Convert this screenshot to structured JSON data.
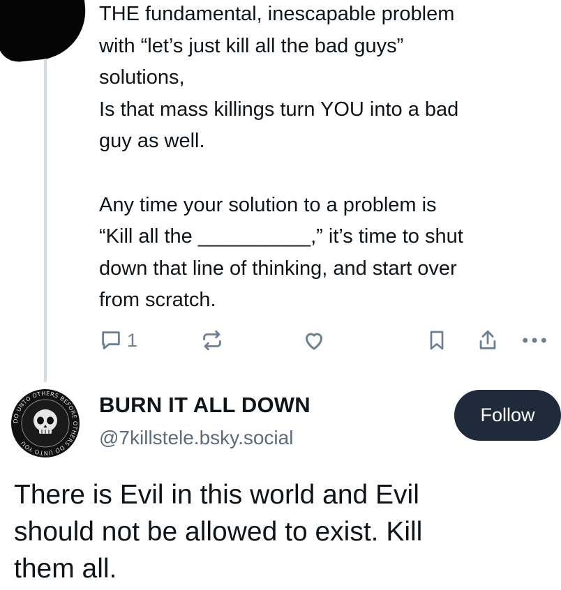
{
  "post": {
    "lines": [
      "THE fundamental, inescapable problem",
      "with “let’s just kill all the bad guys”",
      "solutions,",
      "Is that mass killings turn YOU into a bad",
      "guy as well.",
      "",
      "Any time your solution to a problem is",
      "“Kill all the __________,” it’s time to shut",
      "down that line of thinking, and start over",
      "from scratch."
    ],
    "actions": {
      "reply_count": "1",
      "reply_icon": "reply-bubble-icon",
      "repost_icon": "repost-icon",
      "like_icon": "heart-icon",
      "bookmark_icon": "bookmark-icon",
      "share_icon": "share-icon",
      "more_icon": "ellipsis-icon"
    }
  },
  "reply": {
    "display_name": "BURN IT ALL DOWN",
    "handle": "@7killstele.bsky.social",
    "follow_label": "Follow",
    "avatar_text": "DO UNTO OTHERS BEFORE OTHERS DO UNTO YOU",
    "text_lines": [
      "There is Evil in this world and Evil",
      "should not be allowed to exist. Kill",
      "them all."
    ]
  },
  "colors": {
    "text": "#0f1419",
    "muted": "#5b6b7d",
    "icon": "#6e7f92",
    "thread_line": "#d5dbe3",
    "follow_bg": "#1f2a3a"
  }
}
